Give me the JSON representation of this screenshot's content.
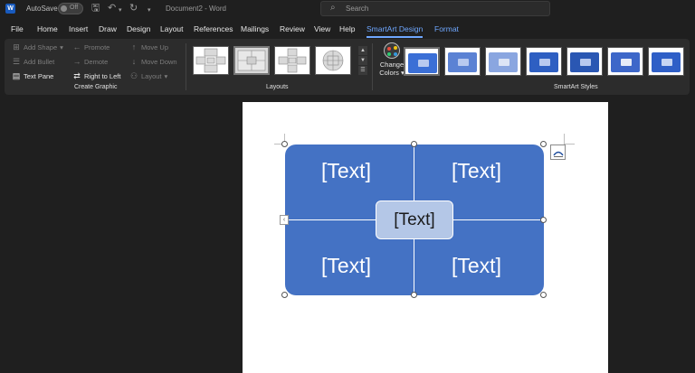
{
  "titlebar": {
    "app_logo": "W",
    "autosave_label": "AutoSave",
    "autosave_state": "Off",
    "doc_title": "Document2 - Word",
    "search_placeholder": "Search",
    "icons": [
      "save-icon",
      "undo-icon",
      "redo-icon"
    ]
  },
  "tabs": [
    "File",
    "Home",
    "Insert",
    "Draw",
    "Design",
    "Layout",
    "References",
    "Mailings",
    "Review",
    "View",
    "Help",
    "SmartArt Design",
    "Format"
  ],
  "active_tab": "SmartArt Design",
  "ribbon": {
    "create_graphic": {
      "label": "Create Graphic",
      "add_shape": "Add Shape",
      "add_bullet": "Add Bullet",
      "text_pane": "Text Pane",
      "promote": "Promote",
      "demote": "Demote",
      "right_to_left": "Right to Left",
      "move_up": "Move Up",
      "move_down": "Move Down",
      "layout": "Layout"
    },
    "layouts": {
      "label": "Layouts",
      "selected_index": 1
    },
    "change_colors": {
      "line1": "Change",
      "line2": "Colors"
    },
    "smartart_styles": {
      "label": "SmartArt Styles",
      "selected_index": 0
    }
  },
  "smartart": {
    "top_left": "[Text]",
    "top_right": "[Text]",
    "center": "[Text]",
    "bottom_left": "[Text]",
    "bottom_right": "[Text]"
  },
  "colors": {
    "accent_tab": "#6fa7ff",
    "shape_fill": "#4472c4",
    "center_fill": "#b4c7e7"
  }
}
